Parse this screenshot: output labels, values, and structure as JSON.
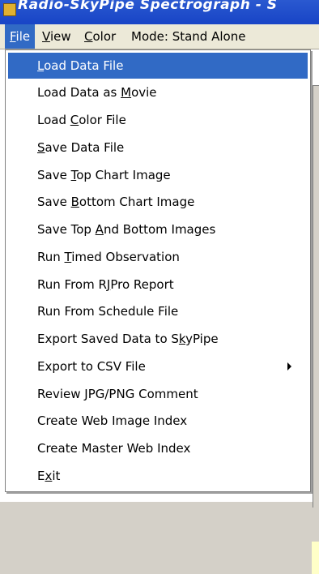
{
  "window": {
    "title": "Radio-SkyPipe Spectrograph - S"
  },
  "menubar": {
    "items": [
      {
        "pre": "",
        "accel": "F",
        "post": "ile"
      },
      {
        "pre": "",
        "accel": "V",
        "post": "iew"
      },
      {
        "pre": "",
        "accel": "C",
        "post": "olor"
      },
      {
        "pre": "Mode: Stand Alone",
        "accel": "",
        "post": ""
      }
    ]
  },
  "file_menu": {
    "items": [
      {
        "pre": "",
        "accel": "L",
        "post": "oad Data File",
        "highlighted": true
      },
      {
        "pre": "Load Data as ",
        "accel": "M",
        "post": "ovie"
      },
      {
        "pre": "Load ",
        "accel": "C",
        "post": "olor File"
      },
      {
        "pre": "",
        "accel": "S",
        "post": "ave Data File"
      },
      {
        "pre": "Save ",
        "accel": "T",
        "post": "op Chart Image"
      },
      {
        "pre": "Save ",
        "accel": "B",
        "post": "ottom Chart Image"
      },
      {
        "pre": "Save Top ",
        "accel": "A",
        "post": "nd Bottom Images"
      },
      {
        "pre": "Run ",
        "accel": "T",
        "post": "imed Observation"
      },
      {
        "pre": "Run From R",
        "accel": "J",
        "post": "Pro Report"
      },
      {
        "pre": "Run From Schedule File",
        "accel": "",
        "post": ""
      },
      {
        "pre": "Export Saved Data to S",
        "accel": "k",
        "post": "yPipe"
      },
      {
        "pre": "Export to CSV File",
        "accel": "",
        "post": "",
        "has_submenu": true
      },
      {
        "pre": "Review JPG/PNG Comment",
        "accel": "",
        "post": ""
      },
      {
        "pre": "Create Web Image Index",
        "accel": "",
        "post": ""
      },
      {
        "pre": "Create Master Web Index",
        "accel": "",
        "post": ""
      },
      {
        "pre": "E",
        "accel": "x",
        "post": "it"
      }
    ]
  },
  "colors": {
    "highlight": "#316ac5",
    "menubar": "#ece9d8",
    "titlebar": "#1844c6"
  }
}
